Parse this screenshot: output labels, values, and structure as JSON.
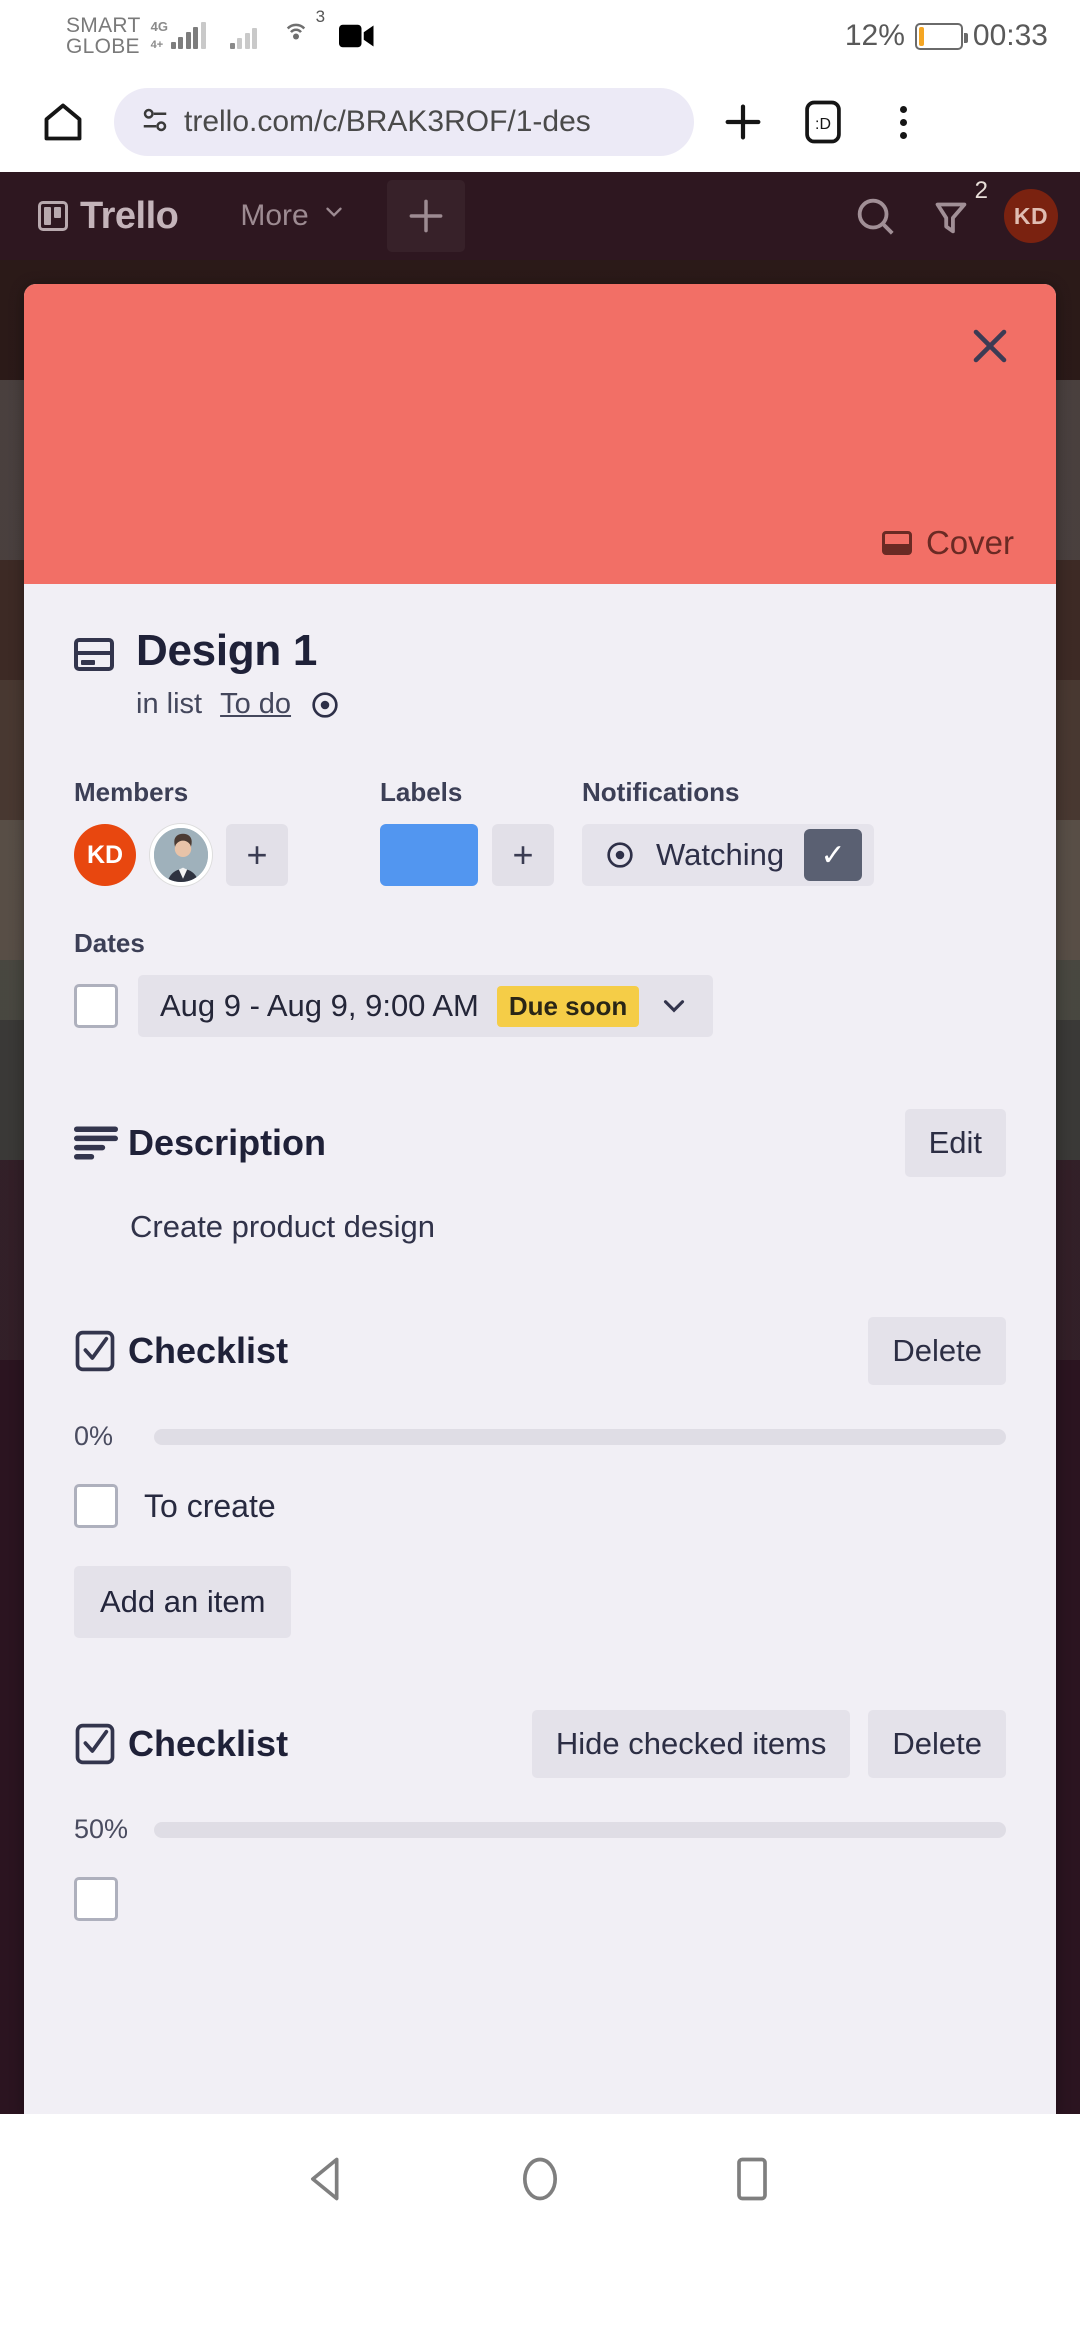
{
  "status_bar": {
    "carrier_line1": "SMART",
    "carrier_line2": "GLOBE",
    "network_type": "4G",
    "network_type2": "4+",
    "hotspot_count": "3",
    "battery_percent": "12%",
    "battery_level": 12,
    "time": "00:33"
  },
  "browser": {
    "url": "trello.com/c/BRAK3ROF/1-des",
    "home_icon": "home-icon",
    "site_settings_icon": "site-settings-icon",
    "new_tab_icon": "plus-icon",
    "tab_count_icon": "tab-switcher-icon",
    "menu_icon": "overflow-menu-icon"
  },
  "trello_header": {
    "logo_text": "Trello",
    "more_label": "More",
    "add_label": "+",
    "search_icon": "search-icon",
    "notification_icon": "notification-bell-icon",
    "notification_badge": "2",
    "avatar_initials": "KD"
  },
  "card": {
    "cover": {
      "color": "#F26F66",
      "close_icon": "close-icon",
      "cover_button_label": "Cover",
      "cover_icon": "cover-icon"
    },
    "title": "Design 1",
    "title_icon": "card-template-icon",
    "in_list_prefix": "in list",
    "list_name": "To do",
    "watch_icon": "watch-eye-icon",
    "members": {
      "label": "Members",
      "avatars": [
        {
          "initials": "KD",
          "color": "#E8470F",
          "type": "initials"
        },
        {
          "initials": "",
          "color": "#9fb1bb",
          "type": "photo"
        }
      ],
      "add_label": "+"
    },
    "labels": {
      "label": "Labels",
      "chips": [
        {
          "color": "#5296F0"
        }
      ],
      "add_label": "+"
    },
    "notifications": {
      "label": "Notifications",
      "watching_label": "Watching",
      "watching_icon": "watch-eye-icon",
      "checked": true,
      "check_glyph": "✓"
    },
    "dates": {
      "label": "Dates",
      "checkbox_checked": false,
      "range_text": "Aug 9 - Aug 9, 9:00 AM",
      "badge_text": "Due soon",
      "badge_color": "#F5CD47",
      "chevron_icon": "chevron-down-icon"
    },
    "description": {
      "title": "Description",
      "icon": "description-lines-icon",
      "edit_label": "Edit",
      "body": "Create product design"
    },
    "checklists": [
      {
        "title": "Checklist",
        "icon": "checklist-icon",
        "buttons": [
          "Delete"
        ],
        "percent_label": "0%",
        "percent_value": 0,
        "items": [
          {
            "label": "To create",
            "checked": false
          }
        ],
        "add_item_label": "Add an item"
      },
      {
        "title": "Checklist",
        "icon": "checklist-icon",
        "buttons": [
          "Hide checked items",
          "Delete"
        ],
        "percent_label": "50%",
        "percent_value": 50,
        "items": [],
        "add_item_label": ""
      }
    ]
  },
  "nav_bar": {
    "back_icon": "back-triangle-icon",
    "home_icon": "home-circle-icon",
    "recents_icon": "recents-square-icon"
  }
}
